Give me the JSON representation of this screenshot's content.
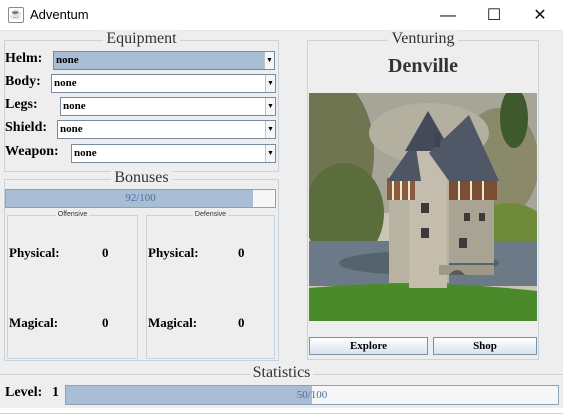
{
  "window": {
    "title": "Adventum",
    "icon": "java-cup-icon",
    "min_glyph": "—",
    "max_glyph": "☐",
    "close_glyph": "✕"
  },
  "equipment": {
    "title": "Equipment",
    "slots": [
      {
        "label": "Helm:",
        "value": "none"
      },
      {
        "label": "Body:",
        "value": "none"
      },
      {
        "label": "Legs:",
        "value": "none"
      },
      {
        "label": "Shield:",
        "value": "none"
      },
      {
        "label": "Weapon:",
        "value": "none"
      }
    ],
    "arrow_glyph": "▼"
  },
  "bonuses": {
    "title": "Bonuses",
    "bar_text": "92/100",
    "bar_fraction": 0.92,
    "offensive": {
      "title": "Offensive",
      "physical_label": "Physical:",
      "physical_value": "0",
      "magical_label": "Magical:",
      "magical_value": "0"
    },
    "defensive": {
      "title": "Defensive",
      "physical_label": "Physical:",
      "physical_value": "0",
      "magical_label": "Magical:",
      "magical_value": "0"
    }
  },
  "venturing": {
    "title": "Venturing",
    "town": "Denville",
    "explore_label": "Explore",
    "shop_label": "Shop"
  },
  "statistics": {
    "title": "Statistics",
    "level_label": "Level:",
    "level_value": "1",
    "xp_text": "50/100",
    "xp_fraction": 0.5
  },
  "colors": {
    "accent": "#a9bdd4",
    "border": "#c8d3de",
    "background": "#eeeeee"
  }
}
